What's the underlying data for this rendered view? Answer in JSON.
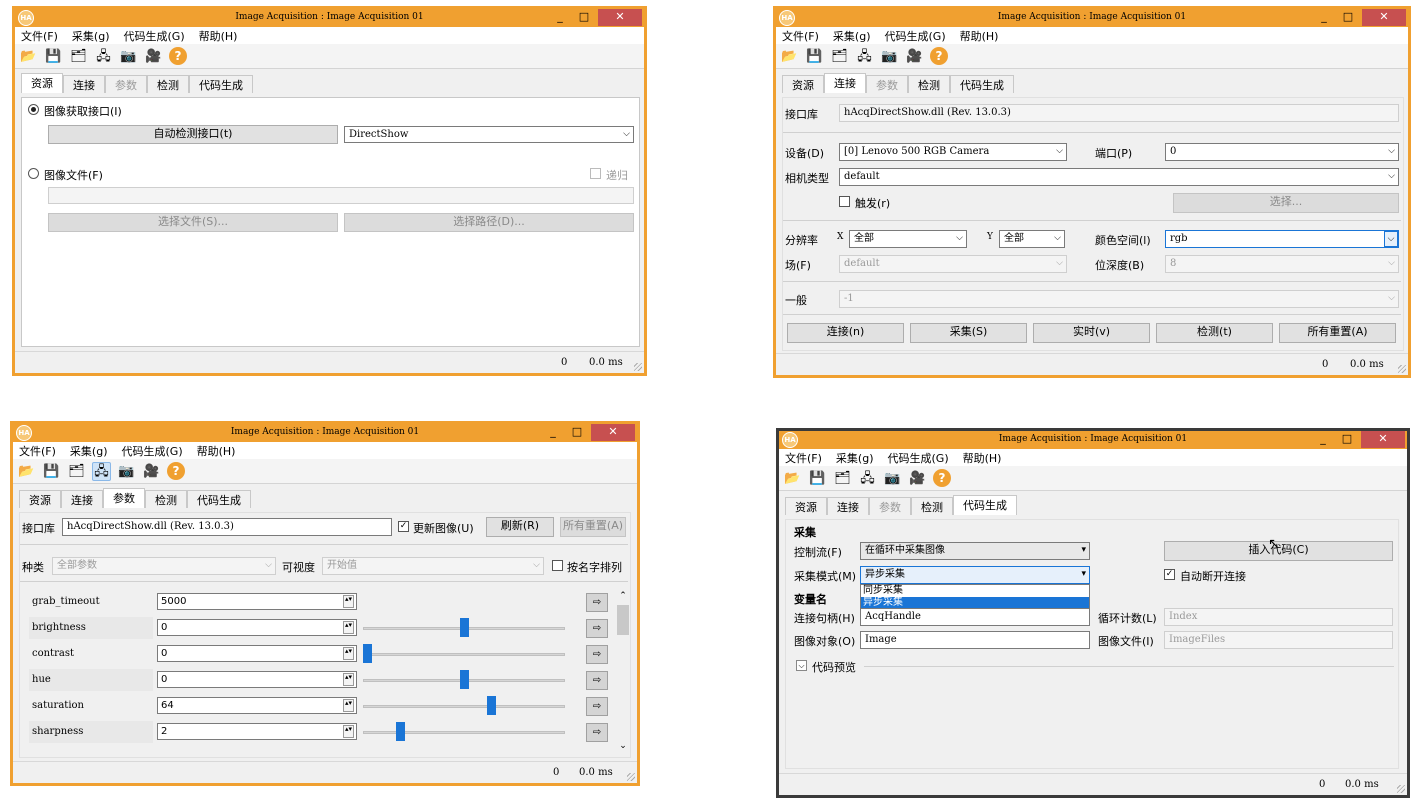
{
  "app": {
    "title": "Image Acquisition : Image Acquisition 01",
    "logo": "HA",
    "minimize": "_",
    "maximize": "□",
    "close": "✕",
    "menu": [
      "文件(F)",
      "采集(g)",
      "代码生成(G)",
      "帮助(H)"
    ],
    "tabs": [
      "资源",
      "连接",
      "参数",
      "检测",
      "代码生成"
    ],
    "toolbar_icons": [
      "open-folder-icon",
      "save-icon",
      "image-file-icon",
      "acquisition-connect-icon",
      "camera-icon",
      "live-camera-icon",
      "help-icon"
    ],
    "help_glyph": "?",
    "accent_color": "#f0a030",
    "selection_color": "#1a75d6"
  },
  "win1": {
    "active_tab": "资源",
    "radio_interface": "图像获取接口(I)",
    "auto_detect": "自动检测接口(t)",
    "interface_value": "DirectShow",
    "radio_file": "图像文件(F)",
    "recursive": "递归",
    "file_path": "",
    "select_file": "选择文件(S)...",
    "select_path": "选择路径(D)...",
    "status_count": "0",
    "status_time": "0.0 ms"
  },
  "win2": {
    "active_tab": "连接",
    "lib_label": "接口库",
    "lib_value": "hAcqDirectShow.dll (Rev. 13.0.3)",
    "device_label": "设备(D)",
    "device_value": "[0] Lenovo 500 RGB Camera",
    "port_label": "端口(P)",
    "port_value": "0",
    "camtype_label": "相机类型",
    "camtype_value": "default",
    "trigger": "触发(r)",
    "select": "选择...",
    "resolution_label": "分辨率",
    "x_label": "X",
    "x_value": "全部",
    "y_label": "Y",
    "y_value": "全部",
    "colorspace_label": "颜色空间(l)",
    "colorspace_value": "rgb",
    "field_label": "场(F)",
    "field_value": "default",
    "bitdepth_label": "位深度(B)",
    "bitdepth_value": "8",
    "general_label": "一般",
    "general_value": "-1",
    "buttons": [
      "连接(n)",
      "采集(S)",
      "实时(v)",
      "检测(t)",
      "所有重置(A)"
    ],
    "status_count": "0",
    "status_time": "0.0 ms"
  },
  "win3": {
    "active_tab": "参数",
    "lib_label": "接口库",
    "lib_value": "hAcqDirectShow.dll (Rev. 13.0.3)",
    "update_image": "更新图像(U)",
    "refresh": "刷新(R)",
    "reset_all": "所有重置(A)",
    "category_label": "种类",
    "category_value": "全部参数",
    "visibility_label": "可视度",
    "visibility_value": "开始值",
    "sort_by_name": "按名字排列",
    "params": [
      {
        "name": "grab_timeout",
        "value": "5000",
        "slider": null
      },
      {
        "name": "brightness",
        "value": "0",
        "slider": 0.5
      },
      {
        "name": "contrast",
        "value": "0",
        "slider": 0.0
      },
      {
        "name": "hue",
        "value": "0",
        "slider": 0.5
      },
      {
        "name": "saturation",
        "value": "64",
        "slider": 0.64
      },
      {
        "name": "sharpness",
        "value": "2",
        "slider": 0.17
      }
    ],
    "status_count": "0",
    "status_time": "0.0 ms"
  },
  "win4": {
    "active_tab": "代码生成",
    "section_acq": "采集",
    "controlflow_label": "控制流(F)",
    "controlflow_value": "在循环中采集图像",
    "insert_code": "插入代码(C)",
    "acqmode_label": "采集模式(M)",
    "acqmode_value": "异步采集",
    "acqmode_options": [
      "同步采集",
      "异步采集"
    ],
    "auto_disconnect": "自动断开连接",
    "section_vars": "变量名",
    "handle_label": "连接句柄(H)",
    "handle_value": "AcqHandle",
    "loopcount_label": "循环计数(L)",
    "loopcount_value": "Index",
    "imgobj_label": "图像对象(O)",
    "imgobj_value": "Image",
    "imgfiles_label": "图像文件(I)",
    "imgfiles_value": "ImageFiles",
    "code_preview": "代码预览",
    "status_count": "0",
    "status_time": "0.0 ms"
  }
}
